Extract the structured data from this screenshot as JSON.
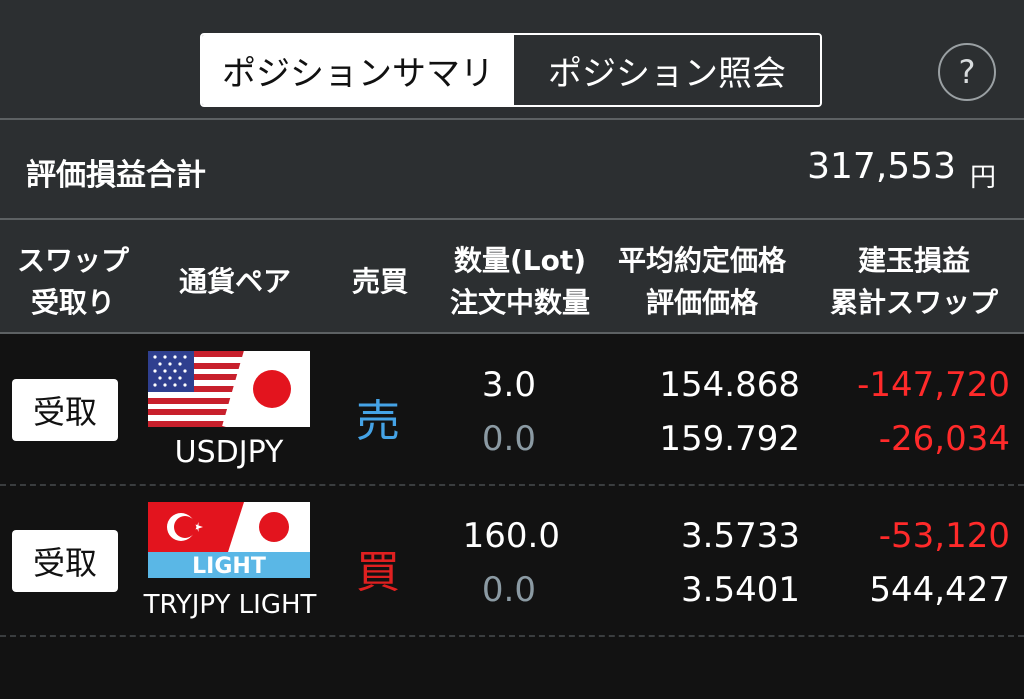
{
  "tabs": {
    "summary_label": "ポジションサマリ",
    "inquiry_label": "ポジション照会"
  },
  "help_label": "?",
  "total": {
    "label": "評価損益合計",
    "value": "317,553",
    "unit": "円"
  },
  "columns": {
    "swap_receive": [
      "スワップ",
      "受取り"
    ],
    "pair": [
      "通貨ペア"
    ],
    "side": [
      "売買"
    ],
    "qty": [
      "数量(Lot)",
      "注文中数量"
    ],
    "price": [
      "平均約定価格",
      "評価価格"
    ],
    "pl": [
      "建玉損益",
      "累計スワップ"
    ]
  },
  "rows": [
    {
      "receive_label": "受取",
      "pair": "USDJPY",
      "flag_icons": [
        "us-flag",
        "japan-flag"
      ],
      "side": "売",
      "quantity": "3.0",
      "order_quantity": "0.0",
      "avg_price": "154.868",
      "eval_price": "159.792",
      "position_pl": "-147,720",
      "cumulative_swap": "-26,034"
    },
    {
      "receive_label": "受取",
      "pair": "TRYJPY LIGHT",
      "flag_icons": [
        "turkey-flag",
        "japan-flag"
      ],
      "flag_badge": "LIGHT",
      "side": "買",
      "quantity": "160.0",
      "order_quantity": "0.0",
      "avg_price": "3.5733",
      "eval_price": "3.5401",
      "position_pl": "-53,120",
      "cumulative_swap": "544,427"
    }
  ],
  "colors": {
    "sell": "#45a3e6",
    "buy": "#e02020",
    "negative": "#ff2a2a",
    "muted": "#8b9aa3"
  }
}
